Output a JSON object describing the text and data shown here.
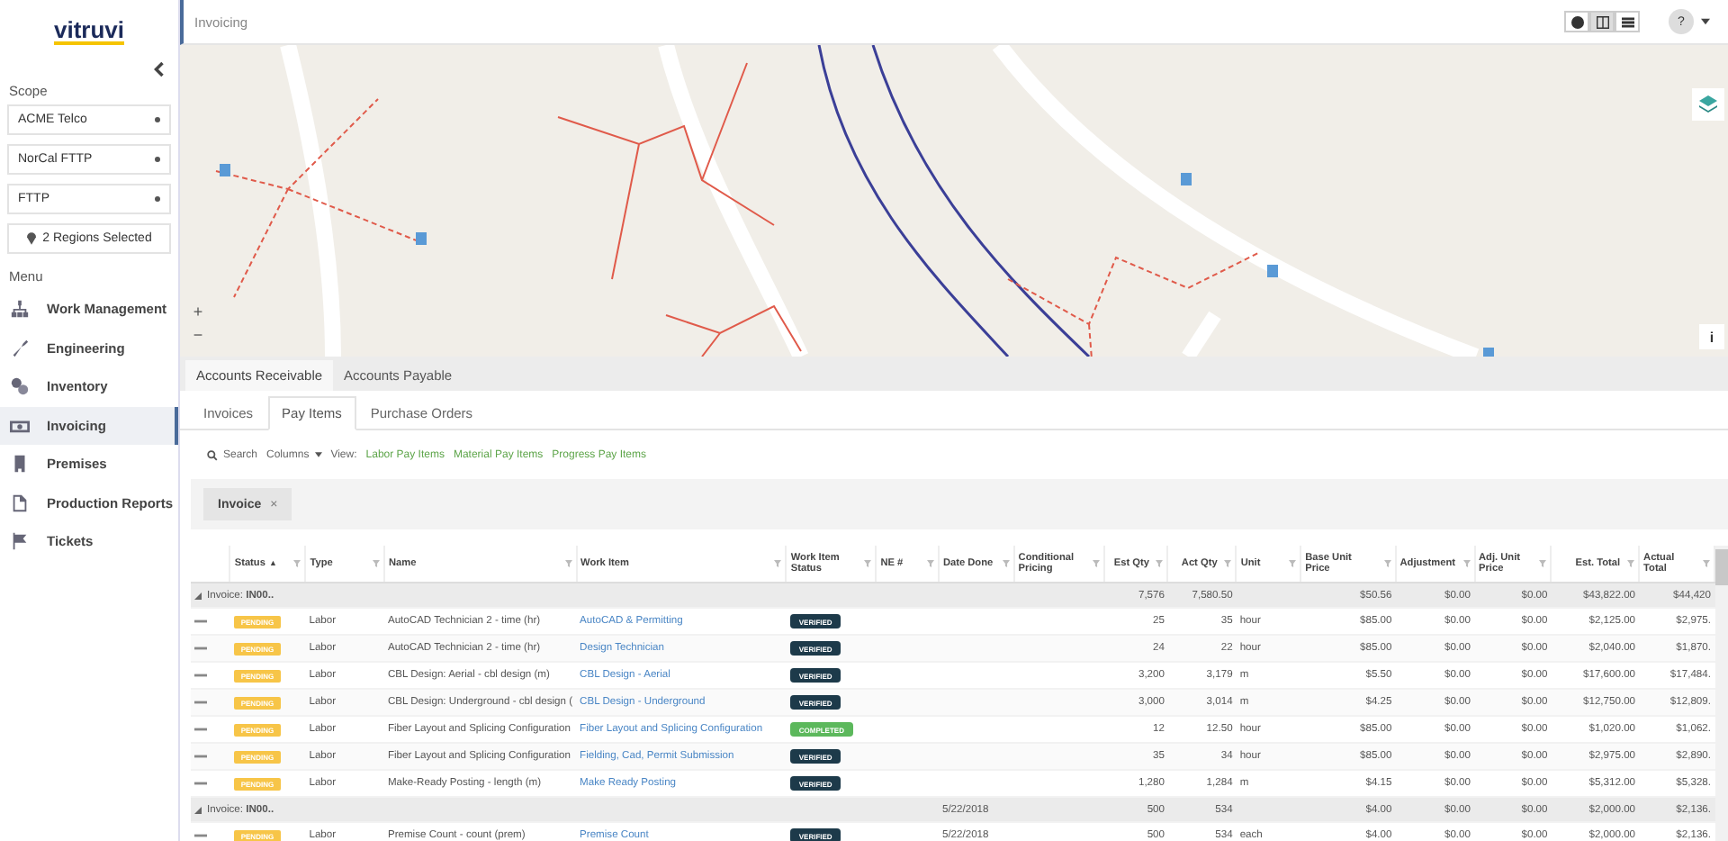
{
  "sidebar": {
    "logo": "vitruvi",
    "scope_label": "Scope",
    "selects": [
      "ACME Telco",
      "NorCal FTTP",
      "FTTP"
    ],
    "regions": "2 Regions Selected",
    "menu_label": "Menu",
    "items": [
      {
        "label": "Work Management",
        "selected": false
      },
      {
        "label": "Engineering",
        "selected": false
      },
      {
        "label": "Inventory",
        "selected": false
      },
      {
        "label": "Invoicing",
        "selected": true
      },
      {
        "label": "Premises",
        "selected": false
      },
      {
        "label": "Production Reports",
        "selected": false
      },
      {
        "label": "Tickets",
        "selected": false
      }
    ]
  },
  "header": {
    "title": "Invoicing",
    "views": [
      {
        "selected": false
      },
      {
        "selected": true
      },
      {
        "selected": false
      }
    ],
    "help": "?"
  },
  "map": {
    "zoom_in": "+",
    "zoom_out": "−",
    "info": "i"
  },
  "outer_tabs": [
    {
      "label": "Accounts Receivable",
      "selected": true
    },
    {
      "label": "Accounts Payable",
      "selected": false
    }
  ],
  "inner_tabs": [
    {
      "label": "Invoices",
      "selected": false
    },
    {
      "label": "Pay Items",
      "selected": true
    },
    {
      "label": "Purchase Orders",
      "selected": false
    }
  ],
  "toolbar": {
    "search": "Search",
    "columns": "Columns",
    "view_label": "View:",
    "views": [
      "Labor Pay Items",
      "Material Pay Items",
      "Progress Pay Items"
    ]
  },
  "group_chip": {
    "label": "Invoice",
    "remove": "×"
  },
  "table": {
    "columns": [
      {
        "label": "Status",
        "sort": "▲"
      },
      {
        "label": "Type"
      },
      {
        "label": "Name"
      },
      {
        "label": "Work Item"
      },
      {
        "label": "Work Item Status"
      },
      {
        "label": "NE #"
      },
      {
        "label": "Date Done"
      },
      {
        "label": "Conditional Pricing"
      },
      {
        "label": "Est Qty"
      },
      {
        "label": "Act Qty"
      },
      {
        "label": "Unit"
      },
      {
        "label": "Base Unit Price"
      },
      {
        "label": "Adjustment"
      },
      {
        "label": "Adj. Unit Price"
      },
      {
        "label": "Est. Total"
      },
      {
        "label": "Actual Total"
      }
    ],
    "rows": [
      {
        "kind": "group",
        "expanded": true,
        "label": "Invoice: **IN00..**",
        "est_qty": "7,576",
        "act_qty": "7,580.50",
        "base_price": "$50.56",
        "adjustment": "$0.00",
        "adj_price": "$0.00",
        "est_total": "$43,822.00",
        "act_total": "$44,420"
      },
      {
        "kind": "item",
        "status": "PENDING",
        "type": "Labor",
        "name": "AutoCAD Technician 2 - time (hr)",
        "work_item": "AutoCAD & Permitting",
        "wi_status": {
          "text": "VERIFIED",
          "kind": "verified"
        },
        "est_qty": "25",
        "act_qty": "35",
        "unit": "hour",
        "base_price": "$85.00",
        "adjustment": "$0.00",
        "adj_price": "$0.00",
        "est_total": "$2,125.00",
        "act_total": "$2,975."
      },
      {
        "kind": "item",
        "status": "PENDING",
        "type": "Labor",
        "name": "AutoCAD Technician 2 - time (hr)",
        "work_item": "Design Technician",
        "wi_status": {
          "text": "VERIFIED",
          "kind": "verified"
        },
        "est_qty": "24",
        "act_qty": "22",
        "unit": "hour",
        "base_price": "$85.00",
        "adjustment": "$0.00",
        "adj_price": "$0.00",
        "est_total": "$2,040.00",
        "act_total": "$1,870."
      },
      {
        "kind": "item",
        "status": "PENDING",
        "type": "Labor",
        "name": "CBL Design: Aerial - cbl design (m)",
        "work_item": "CBL Design - Aerial",
        "wi_status": {
          "text": "VERIFIED",
          "kind": "verified"
        },
        "est_qty": "3,200",
        "act_qty": "3,179",
        "unit": "m",
        "base_price": "$5.50",
        "adjustment": "$0.00",
        "adj_price": "$0.00",
        "est_total": "$17,600.00",
        "act_total": "$17,484."
      },
      {
        "kind": "item",
        "status": "PENDING",
        "type": "Labor",
        "name": "CBL Design: Underground - cbl design (",
        "work_item": "CBL Design - Underground",
        "wi_status": {
          "text": "VERIFIED",
          "kind": "verified"
        },
        "est_qty": "3,000",
        "act_qty": "3,014",
        "unit": "m",
        "base_price": "$4.25",
        "adjustment": "$0.00",
        "adj_price": "$0.00",
        "est_total": "$12,750.00",
        "act_total": "$12,809."
      },
      {
        "kind": "item",
        "status": "PENDING",
        "type": "Labor",
        "name": "Fiber Layout and Splicing Configuration",
        "work_item": "Fiber Layout and Splicing Configuration",
        "wi_status": {
          "text": "COMPLETED",
          "kind": "completed"
        },
        "est_qty": "12",
        "act_qty": "12.50",
        "unit": "hour",
        "base_price": "$85.00",
        "adjustment": "$0.00",
        "adj_price": "$0.00",
        "est_total": "$1,020.00",
        "act_total": "$1,062."
      },
      {
        "kind": "item",
        "status": "PENDING",
        "type": "Labor",
        "name": "Fiber Layout and Splicing Configuration",
        "work_item": "Fielding, Cad, Permit Submission",
        "wi_status": {
          "text": "VERIFIED",
          "kind": "verified"
        },
        "est_qty": "35",
        "act_qty": "34",
        "unit": "hour",
        "base_price": "$85.00",
        "adjustment": "$0.00",
        "adj_price": "$0.00",
        "est_total": "$2,975.00",
        "act_total": "$2,890."
      },
      {
        "kind": "item",
        "status": "PENDING",
        "type": "Labor",
        "name": "Make-Ready Posting - length (m)",
        "work_item": "Make Ready Posting",
        "wi_status": {
          "text": "VERIFIED",
          "kind": "verified"
        },
        "est_qty": "1,280",
        "act_qty": "1,284",
        "unit": "m",
        "base_price": "$4.15",
        "adjustment": "$0.00",
        "adj_price": "$0.00",
        "est_total": "$5,312.00",
        "act_total": "$5,328."
      },
      {
        "kind": "group",
        "expanded": true,
        "label": "Invoice: **IN00..**",
        "date_done": "5/22/2018",
        "est_qty": "500",
        "act_qty": "534",
        "base_price": "$4.00",
        "adjustment": "$0.00",
        "adj_price": "$0.00",
        "est_total": "$2,000.00",
        "act_total": "$2,136."
      },
      {
        "kind": "item",
        "status": "PENDING",
        "type": "Labor",
        "name": "Premise Count - count (prem)",
        "work_item": "Premise Count",
        "wi_status": {
          "text": "VERIFIED",
          "kind": "verified"
        },
        "date_done": "5/22/2018",
        "est_qty": "500",
        "act_qty": "534",
        "unit": "each",
        "base_price": "$4.00",
        "adjustment": "$0.00",
        "adj_price": "$0.00",
        "est_total": "$2,000.00",
        "act_total": "$2,136."
      }
    ]
  }
}
